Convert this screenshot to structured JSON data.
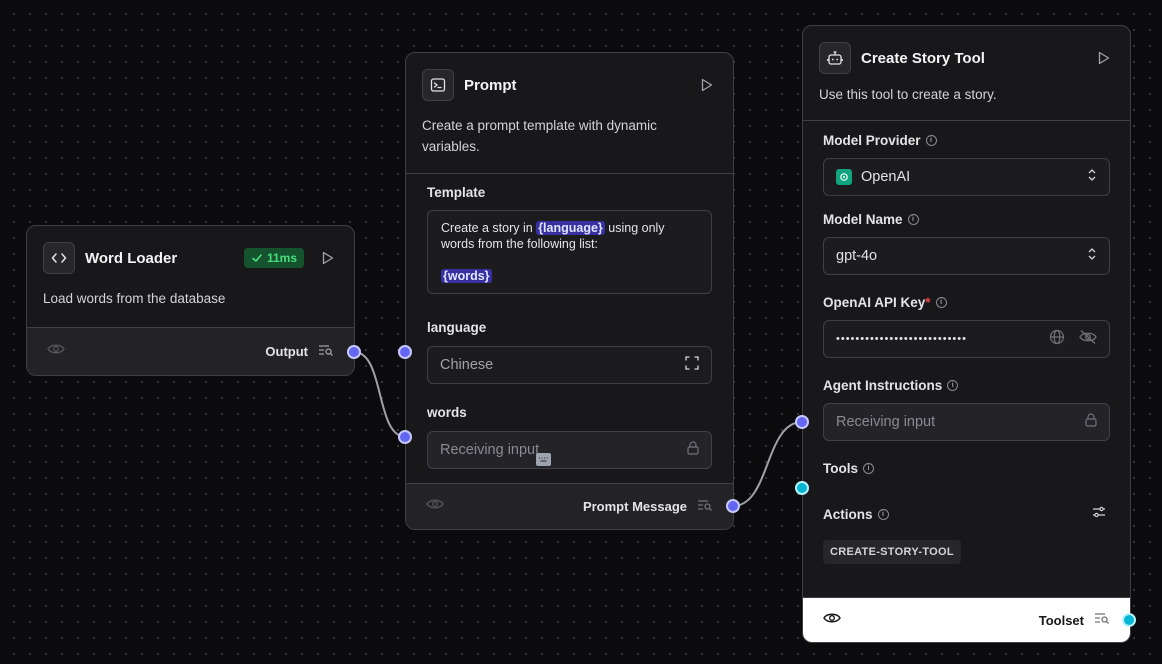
{
  "word_loader": {
    "title": "Word Loader",
    "badge": "11ms",
    "description": "Load words from the database",
    "output_label": "Output"
  },
  "prompt": {
    "title": "Prompt",
    "description": "Create a prompt template with dynamic variables.",
    "template_label": "Template",
    "template": {
      "prefix": "Create a story in ",
      "var1": "{language}",
      "middle": " using only words from the following list:",
      "var2": "{words}"
    },
    "language_label": "language",
    "language_value": "Chinese",
    "words_label": "words",
    "words_value": "Receiving input",
    "output_label": "Prompt Message"
  },
  "story_tool": {
    "title": "Create Story Tool",
    "description": "Use this tool to create a story.",
    "model_provider_label": "Model Provider",
    "model_provider_value": "OpenAI",
    "model_name_label": "Model Name",
    "model_name_value": "gpt-4o",
    "api_key_label": "OpenAI API Key",
    "api_key_required": "*",
    "api_key_value": "•••••••••••••••••••••••••••",
    "agent_instructions_label": "Agent Instructions",
    "agent_instructions_value": "Receiving input",
    "tools_label": "Tools",
    "actions_label": "Actions",
    "action_tag": "CREATE-STORY-TOOL",
    "output_label": "Toolset"
  },
  "colors": {
    "handle_indigo": "#6366f1",
    "handle_cyan": "#06b6d4",
    "badge_green": "#4ade80",
    "openai_green": "#10a37f"
  }
}
